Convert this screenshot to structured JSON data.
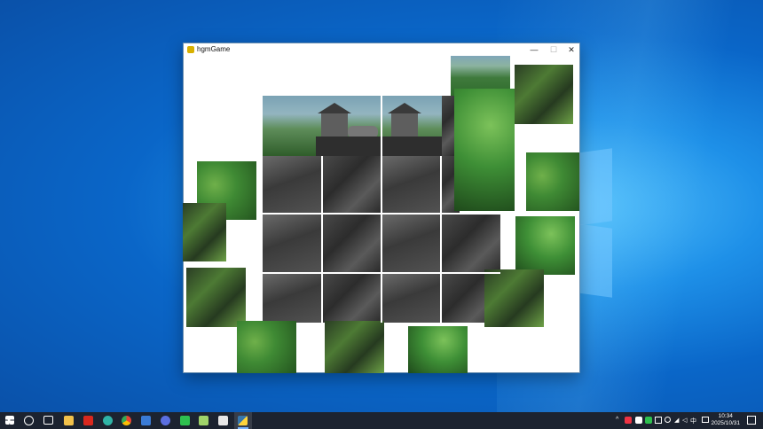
{
  "window": {
    "title": "hgmGame",
    "minimize_label": "—",
    "maximize_label": "☐",
    "close_label": "✕"
  },
  "puzzle": {
    "pieces": [
      "temple-left",
      "temple-right",
      "sky-topright",
      "cliff-right",
      "rock-r2c1",
      "rock-r2c2",
      "rock-r2c3",
      "rock-r2c4",
      "rock-r3c1",
      "rock-r3c2",
      "rock-r3c3",
      "rock-r3c4",
      "rock-r4c1",
      "rock-r4c2",
      "rock-r4c3",
      "rock-r4c4",
      "loose-green-left",
      "loose-moss-left",
      "loose-moss-left2",
      "loose-green-bottom",
      "loose-moss-bottom",
      "loose-green-bottom2",
      "loose-green-right",
      "loose-moss-right",
      "loose-topright"
    ]
  },
  "taskbar": {
    "apps": [
      "start",
      "search",
      "task-view",
      "file-explorer",
      "wps",
      "edge",
      "chrome",
      "browser",
      "wechat",
      "notepad",
      "network",
      "python"
    ],
    "clock_time": "10:34",
    "clock_date": "2025/10/31",
    "ime_label": "中"
  }
}
